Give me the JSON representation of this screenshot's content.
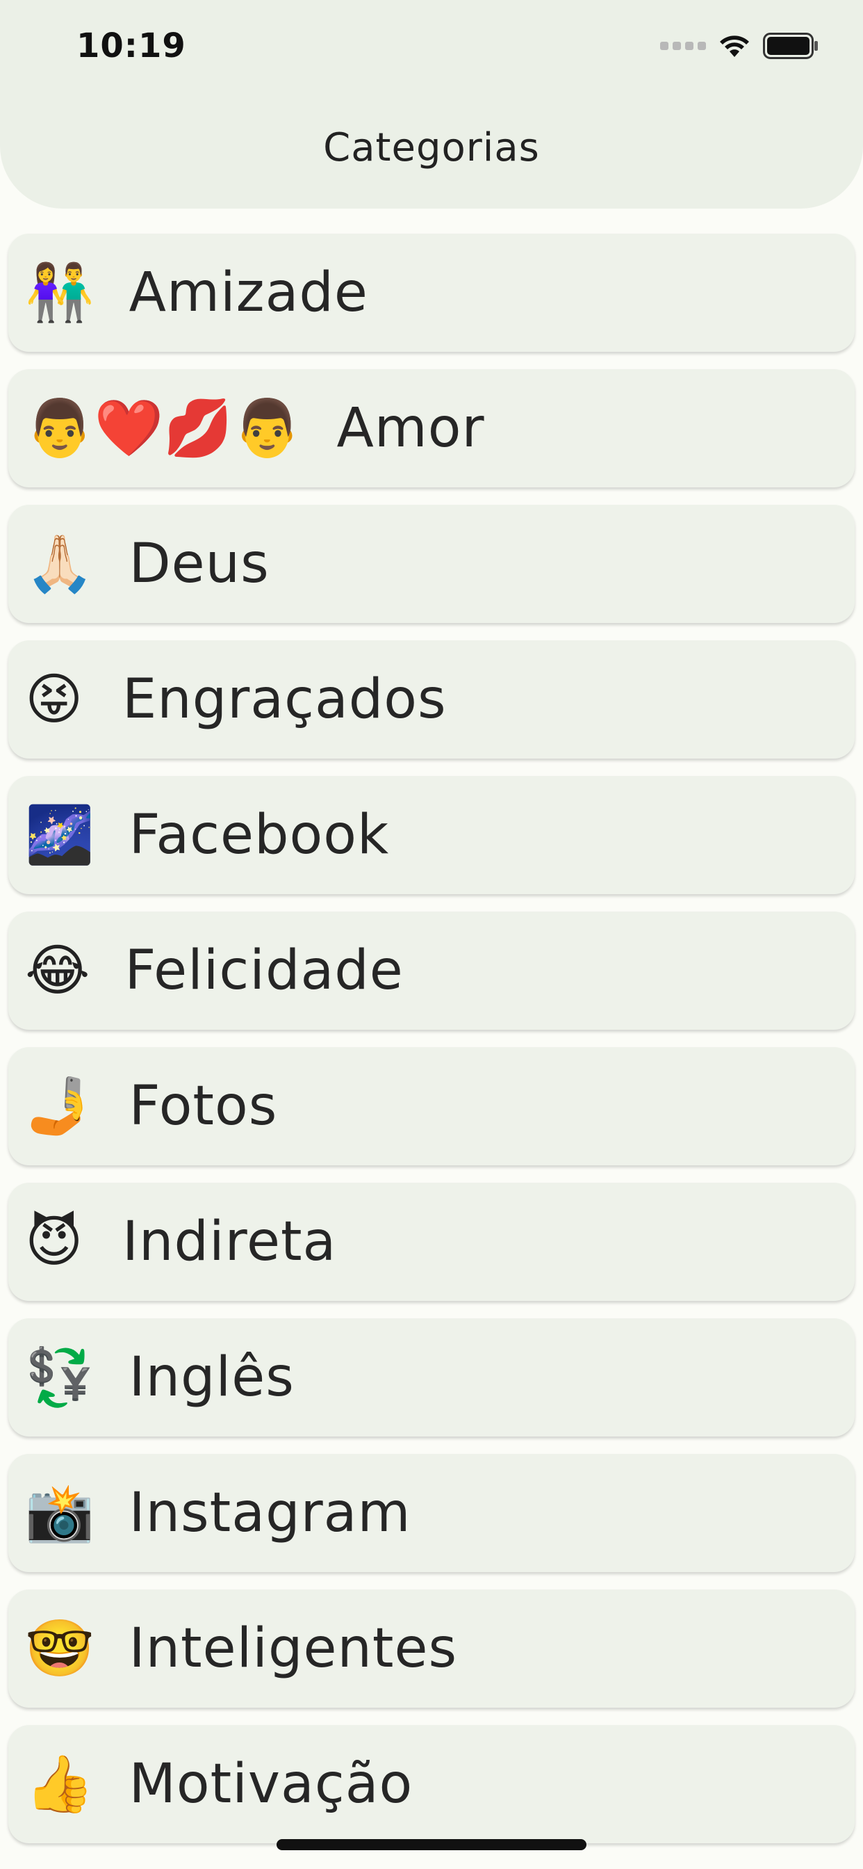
{
  "status_bar": {
    "time": "10:19",
    "icons": [
      "cellular-signal-icon",
      "wifi-icon",
      "battery-icon"
    ]
  },
  "header": {
    "title": "Categorias"
  },
  "categories": [
    {
      "emoji": "👫",
      "label": "Amizade"
    },
    {
      "emoji": "👨❤️💋👨",
      "label": "Amor"
    },
    {
      "emoji": "🙏🏻",
      "label": "Deus"
    },
    {
      "emoji": "😝",
      "label": "Engraçados"
    },
    {
      "emoji": "🌌",
      "label": "Facebook"
    },
    {
      "emoji": "😂",
      "label": "Felicidade"
    },
    {
      "emoji": "🤳",
      "label": "Fotos"
    },
    {
      "emoji": "😈",
      "label": "Indireta"
    },
    {
      "emoji": "💱",
      "label": "Inglês"
    },
    {
      "emoji": "📸",
      "label": "Instagram"
    },
    {
      "emoji": "🤓",
      "label": "Inteligentes"
    },
    {
      "emoji": "👍",
      "label": "Motivação"
    }
  ],
  "colors": {
    "background": "#fbfcf7",
    "header": "#ebf0e7",
    "card": "#eef2ea",
    "text": "#262626"
  }
}
